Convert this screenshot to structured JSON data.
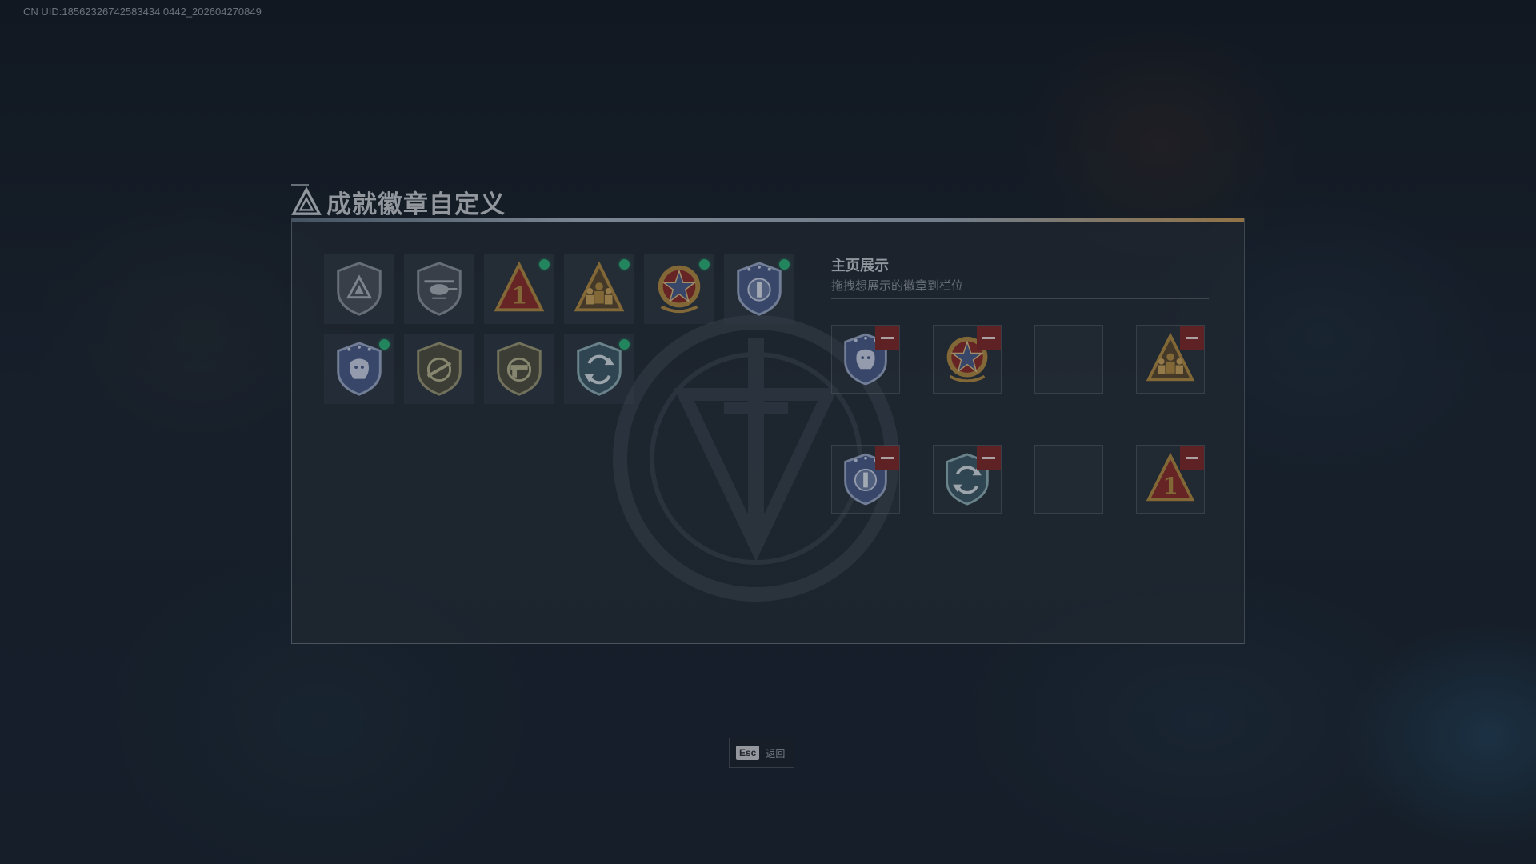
{
  "uid_text": "CN UID:18562326742583434 0442_202604270849",
  "title": "成就徽章自定义",
  "showcase": {
    "title": "主页展示",
    "subtitle": "拖拽想展示的徽章到栏位"
  },
  "badges": [
    {
      "icon": "triangle-shield-badge-icon",
      "equipped": false
    },
    {
      "icon": "helicopter-shield-badge-icon",
      "equipped": false
    },
    {
      "icon": "number-one-triangle-badge-icon",
      "equipped": true
    },
    {
      "icon": "squad-triangle-badge-icon",
      "equipped": true
    },
    {
      "icon": "star-emblem-badge-icon",
      "equipped": true
    },
    {
      "icon": "blue-crest-badge-icon",
      "equipped": true
    },
    {
      "icon": "lion-crest-badge-icon",
      "equipped": true
    },
    {
      "icon": "rifle-shield-badge-icon",
      "equipped": false
    },
    {
      "icon": "pistol-shield-badge-icon",
      "equipped": false
    },
    {
      "icon": "arrows-crest-badge-icon",
      "equipped": true
    }
  ],
  "slots": [
    {
      "icon": "lion-crest-badge-icon",
      "filled": true
    },
    {
      "icon": "star-emblem-badge-icon",
      "filled": true
    },
    {
      "icon": "",
      "filled": false
    },
    {
      "icon": "squad-triangle-badge-icon",
      "filled": true
    },
    {
      "icon": "blue-crest-badge-icon",
      "filled": true
    },
    {
      "icon": "arrows-crest-badge-icon",
      "filled": true
    },
    {
      "icon": "",
      "filled": false
    },
    {
      "icon": "number-one-triangle-badge-icon",
      "filled": true
    }
  ],
  "esc": {
    "key": "Esc",
    "label": "返回"
  },
  "colors": {
    "equipped_dot": "#2bb37a",
    "remove_button": "#7e2a2c",
    "gold": "#b08a45",
    "red": "#8a2f2a",
    "blue": "#4a5d8a"
  }
}
